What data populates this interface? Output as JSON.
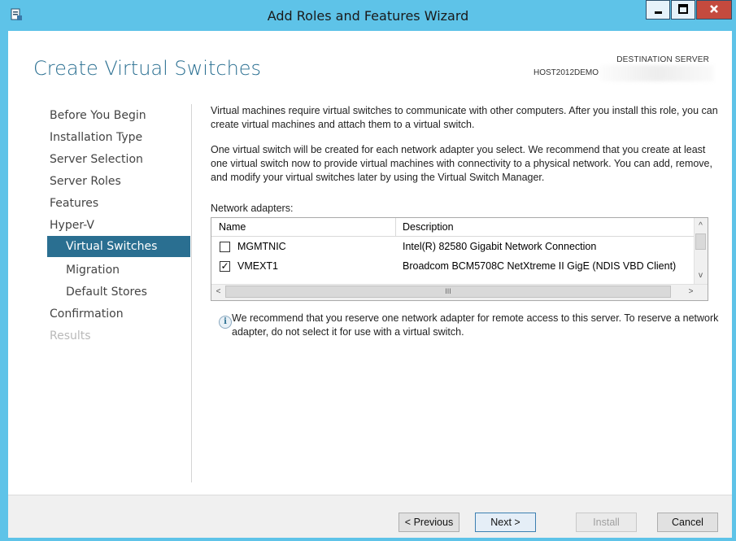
{
  "window": {
    "title": "Add Roles and Features Wizard",
    "accent": "#5ec3e8"
  },
  "header": {
    "page_title": "Create Virtual Switches",
    "destination_label": "DESTINATION SERVER",
    "destination_host": "HOST2012DEMO"
  },
  "nav": {
    "items": [
      {
        "label": "Before You Begin",
        "state": "normal"
      },
      {
        "label": "Installation Type",
        "state": "normal"
      },
      {
        "label": "Server Selection",
        "state": "normal"
      },
      {
        "label": "Server Roles",
        "state": "normal"
      },
      {
        "label": "Features",
        "state": "normal"
      },
      {
        "label": "Hyper-V",
        "state": "normal"
      },
      {
        "label": "Virtual Switches",
        "state": "selected"
      },
      {
        "label": "Migration",
        "state": "normal"
      },
      {
        "label": "Default Stores",
        "state": "normal"
      },
      {
        "label": "Confirmation",
        "state": "normal"
      },
      {
        "label": "Results",
        "state": "disabled"
      }
    ]
  },
  "content": {
    "para1": "Virtual machines require virtual switches to communicate with other computers. After you install this role, you can create virtual machines and attach them to a virtual switch.",
    "para2": "One virtual switch will be created for each network adapter you select. We recommend that you create at least one virtual switch now to provide virtual machines with connectivity to a physical network. You can add, remove, and modify your virtual switches later by using the Virtual Switch Manager.",
    "adapters_label": "Network adapters:",
    "columns": [
      "Name",
      "Description"
    ],
    "rows": [
      {
        "name": "MGMTNIC",
        "description": "Intel(R) 82580 Gigabit Network Connection",
        "checked": false
      },
      {
        "name": "VMEXT1",
        "description": "Broadcom BCM5708C NetXtreme II GigE (NDIS VBD Client)",
        "checked": true
      }
    ],
    "info": "We recommend that you reserve one network adapter for remote access to this server. To reserve a network adapter, do not select it for use with a virtual switch."
  },
  "footer": {
    "previous": "< Previous",
    "next": "Next >",
    "install": "Install",
    "cancel": "Cancel"
  },
  "glyphs": {
    "check": "✓",
    "up": "^",
    "down": "v",
    "left": "<",
    "right": ">",
    "grip": "III",
    "info": "i"
  }
}
